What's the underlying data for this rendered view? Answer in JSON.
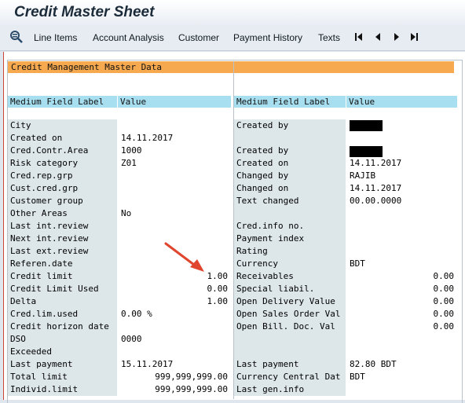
{
  "window": {
    "title": "Credit Master Sheet"
  },
  "toolbar": {
    "items": [
      "Line Items",
      "Account Analysis",
      "Customer",
      "Payment History",
      "Texts"
    ],
    "icons": [
      "detail-view-icon",
      "first-page-icon",
      "previous-page-icon",
      "next-page-icon",
      "last-page-icon"
    ]
  },
  "section": {
    "title": "Credit Management Master Data"
  },
  "left_table": {
    "headers": [
      "Medium Field Label",
      "Value"
    ],
    "rows": [
      {
        "label": "City",
        "value": ""
      },
      {
        "label": "Created on",
        "value": "14.11.2017"
      },
      {
        "label": "Cred.Contr.Area",
        "value": "1000"
      },
      {
        "label": "Risk category",
        "value": "Z01"
      },
      {
        "label": "Cred.rep.grp",
        "value": ""
      },
      {
        "label": "Cust.cred.grp",
        "value": ""
      },
      {
        "label": "Customer group",
        "value": ""
      },
      {
        "label": "Other Areas",
        "value": "No"
      },
      {
        "label": "Last int.review",
        "value": ""
      },
      {
        "label": "Next int.review",
        "value": ""
      },
      {
        "label": "Last ext.review",
        "value": ""
      },
      {
        "label": "Referen.date",
        "value": ""
      },
      {
        "label": "Credit limit",
        "value": "1.00"
      },
      {
        "label": "Credit Limit Used",
        "value": "0.00"
      },
      {
        "label": "Delta",
        "value": "1.00"
      },
      {
        "label": "Cred.lim.used",
        "value": "0.00 %"
      },
      {
        "label": "Credit horizon date",
        "value": ""
      },
      {
        "label": "DSO",
        "value": "0000"
      },
      {
        "label": "Exceeded",
        "value": ""
      },
      {
        "label": "Last payment",
        "value": "15.11.2017"
      },
      {
        "label": "Total limit",
        "value": "999,999,999.00"
      },
      {
        "label": "Individ.limit",
        "value": "999,999,999.00"
      }
    ]
  },
  "right_table": {
    "headers": [
      "Medium Field Label",
      "Value"
    ],
    "rows": [
      {
        "label": "Created by",
        "value": ""
      },
      {
        "label": "",
        "value": ""
      },
      {
        "label": "Created by",
        "value": ""
      },
      {
        "label": "Created on",
        "value": "14.11.2017"
      },
      {
        "label": "Changed by",
        "value": "RAJIB"
      },
      {
        "label": "Changed on",
        "value": "14.11.2017"
      },
      {
        "label": "Text changed",
        "value": "00.00.0000"
      },
      {
        "label": "",
        "value": ""
      },
      {
        "label": "Cred.info no.",
        "value": ""
      },
      {
        "label": "Payment index",
        "value": ""
      },
      {
        "label": "Rating",
        "value": ""
      },
      {
        "label": "Currency",
        "value": "BDT"
      },
      {
        "label": "Receivables",
        "value": "0.00"
      },
      {
        "label": "Special liabil.",
        "value": "0.00"
      },
      {
        "label": "Open Delivery Value",
        "value": "0.00"
      },
      {
        "label": "Open Sales Order Val",
        "value": "0.00"
      },
      {
        "label": "Open Bill. Doc. Val",
        "value": "0.00"
      },
      {
        "label": "",
        "value": ""
      },
      {
        "label": "",
        "value": ""
      },
      {
        "label": "Last payment",
        "value": "82.80 BDT"
      },
      {
        "label": "Currency Central Dat",
        "value": "BDT"
      },
      {
        "label": "Last gen.info",
        "value": ""
      }
    ]
  },
  "colors": {
    "section_header": "#f6a94e",
    "column_header": "#a8dff0",
    "label_bg": "#dde6e9",
    "arrow": "#e0452e"
  }
}
